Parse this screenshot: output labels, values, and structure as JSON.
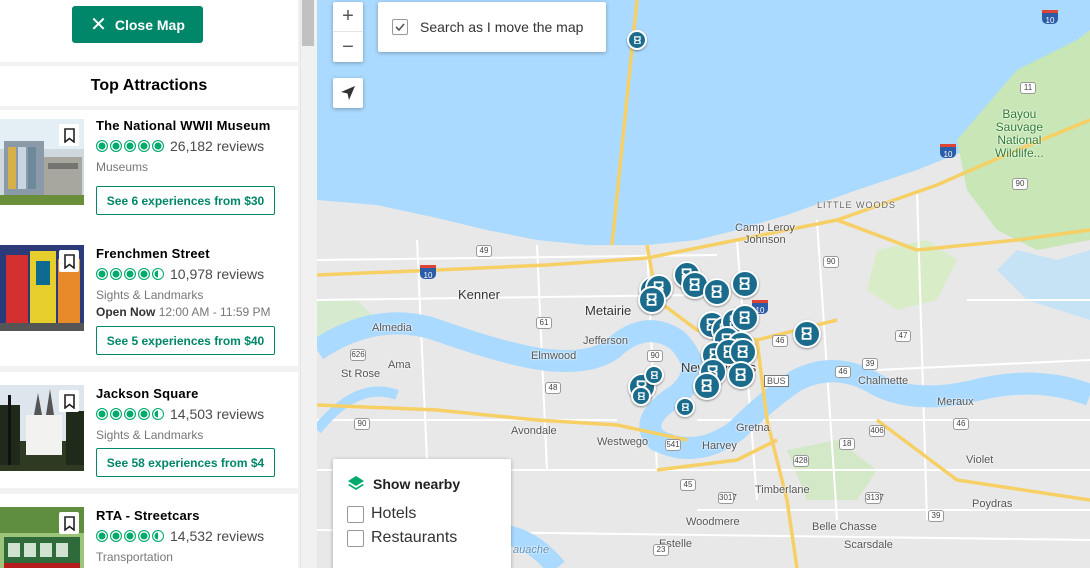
{
  "sidebar": {
    "close_map_label": "Close Map",
    "section_title": "Top Attractions",
    "attractions": [
      {
        "name": "The National WWII Museum",
        "reviews": "26,182 reviews",
        "category": "Museums",
        "hours_label": "",
        "hours": "",
        "experiences": "See 6 experiences from $30",
        "rating": 5
      },
      {
        "name": "Frenchmen Street",
        "reviews": "10,978 reviews",
        "category": "Sights & Landmarks",
        "hours_label": "Open Now",
        "hours": "12:00 AM - 11:59 PM",
        "experiences": "See 5 experiences from $40",
        "rating": 4.5
      },
      {
        "name": "Jackson Square",
        "reviews": "14,503 reviews",
        "category": "Sights & Landmarks",
        "hours_label": "",
        "hours": "",
        "experiences": "See 58 experiences from $4",
        "rating": 4.5
      },
      {
        "name": "RTA - Streetcars",
        "reviews": "14,532 reviews",
        "category": "Transportation",
        "hours_label": "",
        "hours": "",
        "experiences": "",
        "rating": 4.5
      }
    ]
  },
  "map": {
    "zoom_in": "+",
    "zoom_out": "−",
    "search_as_move_label": "Search as I move the map",
    "search_as_move_checked": true,
    "show_nearby": {
      "title": "Show nearby",
      "options": [
        "Hotels",
        "Restaurants"
      ]
    },
    "labels": {
      "kenner": "Kenner",
      "metairie": "Metairie",
      "jefferson": "Jefferson",
      "elmwood": "Elmwood",
      "almedia": "Almedia",
      "ama": "Ama",
      "st_rose": "St Rose",
      "avondale": "Avondale",
      "westwego": "Westwego",
      "harvey": "Harvey",
      "gretna": "Gretna",
      "timberlane": "Timberlane",
      "woodmere": "Woodmere",
      "estelle": "Estelle",
      "belle_chasse": "Belle Chasse",
      "scarsdale": "Scarsdale",
      "violet": "Violet",
      "poydras": "Poydras",
      "meraux": "Meraux",
      "chalmette": "Chalmette",
      "camp_leroy": "Camp Leroy",
      "johnson": "Johnson",
      "little_woods": "LITTLE WOODS",
      "new_orleans": "New Orleans",
      "bayou": "Bayou",
      "sauvage": "Sauvage",
      "national": "National",
      "wildlife": "Wildlife...",
      "bus": "BUS",
      "auache": "auache"
    },
    "shields": {
      "i10a": "10",
      "i10b": "10",
      "i10c": "10",
      "i10d": "10",
      "r11": "11",
      "r90a": "90",
      "r90b": "90",
      "r90c": "90",
      "r90d": "90",
      "r90e": "90",
      "r49": "49",
      "r61": "61",
      "r626": "626",
      "r48": "48",
      "r47": "47",
      "r46a": "46",
      "r46b": "46",
      "r39a": "39",
      "r39b": "39",
      "r406": "406",
      "r46c": "46",
      "r428": "428",
      "r3017": "3017",
      "r3137": "3137",
      "r45": "45",
      "r23": "23",
      "r541": "541",
      "r18": "18"
    },
    "colors": {
      "water": "#aadaff",
      "land": "#e8e8e8",
      "park": "#c8e6b6",
      "highway": "#f6cf65",
      "pin": "#1b6c8c",
      "accent": "#00876a"
    },
    "icons": [
      "zoom-in-icon",
      "zoom-out-icon",
      "locate-arrow-icon",
      "layers-icon",
      "attraction-pin-icon",
      "bookmark-icon",
      "close-icon"
    ]
  }
}
